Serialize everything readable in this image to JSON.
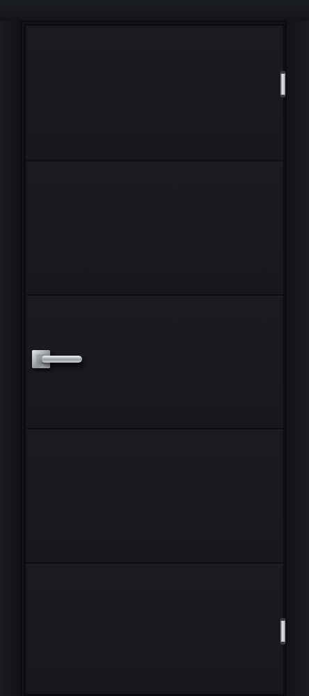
{
  "door": {
    "color": "#17191f",
    "frame_color": "#14161c",
    "panels": 5,
    "handle": "lever-handle-chrome",
    "hinges": 2
  }
}
